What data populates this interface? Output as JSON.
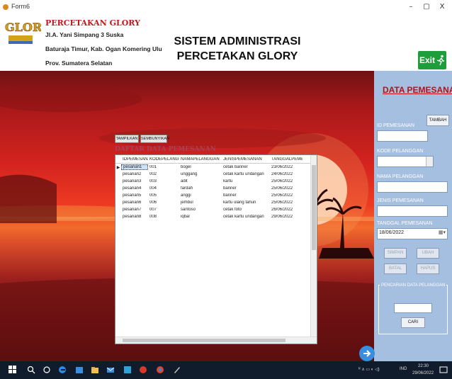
{
  "window": {
    "title": "Form6",
    "minimize": "–",
    "maximize": "▢",
    "close": "X"
  },
  "header": {
    "logo_text_top": "GLORY",
    "logo_text_bottom": "",
    "company_name": "PERCETAKAN GLORY",
    "address_line1": "Jl.A. Yani Simpang 3 Suska",
    "address_line2": "Baturaja Timur, Kab. Ogan Komering Ulu",
    "address_line3": "Prov. Sumatera Selatan",
    "title_line1": "SISTEM ADMINISTRASI",
    "title_line2": "PERCETAKAN GLORY",
    "exit_label": "Exit"
  },
  "grid": {
    "show_button": "TAMPILKAN",
    "hide_button": "SEMBUNYIKAN",
    "title": "DAFTAR DATA PEMESANAN",
    "columns": [
      "IDPEMESANAN",
      "KODEPELANGGAN",
      "NAMAPELANGGAN",
      "JENISPEMESANAN",
      "TANGGALPEMESAN"
    ],
    "rows": [
      [
        "pesanan1",
        "001",
        "bogel",
        "cetak banner",
        "23/06/2022"
      ],
      [
        "pesanan2",
        "002",
        "unggang",
        "cetak kartu undangan",
        "24/06/2022"
      ],
      [
        "pesanan3",
        "003",
        "adit",
        "kartu",
        "25/06/2022"
      ],
      [
        "pesanan4",
        "004",
        "fardah",
        "banner",
        "25/06/2022"
      ],
      [
        "pesanan5",
        "005",
        "anggi",
        "banner",
        "25/06/2022"
      ],
      [
        "pesanan6",
        "006",
        "jembul",
        "kartu ulang tahun",
        "25/06/2022"
      ],
      [
        "pesanan7",
        "007",
        "santoso",
        "cetak foto",
        "26/06/2022"
      ],
      [
        "pesanan8",
        "008",
        "iqbal",
        "cetak kartu undangan",
        "29/06/2022"
      ]
    ]
  },
  "form": {
    "title": "DATA PEMESANAN",
    "add_button": "TAMBAH",
    "id_label": "ID PEMESANAN",
    "id_value": "",
    "kode_label": "KODE PELANGGAN",
    "kode_value": "",
    "nama_label": "NAMA PELANGGAN",
    "nama_value": "",
    "jenis_label": "JENIS PEMESANAN",
    "jenis_value": "",
    "tanggal_label": "TANGGAL PEMESANAN",
    "tanggal_value": "18/06/2022",
    "save_button": "SIMPAN",
    "edit_button": "UBAH",
    "cancel_button": "BATAL",
    "delete_button": "HAPUS",
    "search_label": "PENCARIAN DATA PELANGGAN",
    "search_value": "",
    "find_button": "CARI"
  },
  "taskbar": {
    "time": "22:30",
    "date": "29/06/2022",
    "lang": "IND"
  },
  "colors": {
    "accent_red": "#c4161c",
    "exit_green": "#1e9e3a",
    "panel_blue": "#a5bfe0"
  }
}
